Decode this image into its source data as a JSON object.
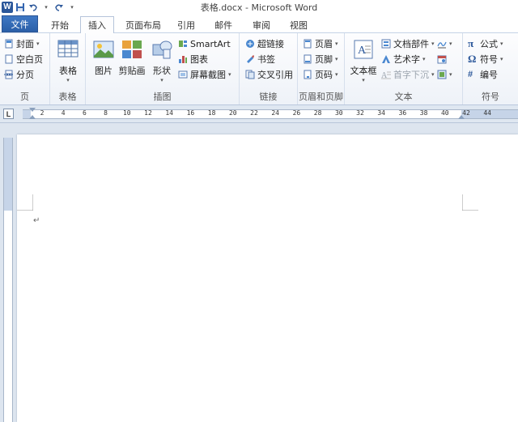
{
  "titlebar": {
    "title": "表格.docx - Microsoft Word",
    "logo": "W"
  },
  "tabs": [
    {
      "label": "文件"
    },
    {
      "label": "开始"
    },
    {
      "label": "插入"
    },
    {
      "label": "页面布局"
    },
    {
      "label": "引用"
    },
    {
      "label": "邮件"
    },
    {
      "label": "审阅"
    },
    {
      "label": "视图"
    }
  ],
  "ribbon": {
    "pages": {
      "label": "页",
      "cover": "封面",
      "blank": "空白页",
      "break": "分页"
    },
    "tables": {
      "label": "表格",
      "table": "表格"
    },
    "illustrations": {
      "label": "插图",
      "picture": "图片",
      "clipart": "剪贴画",
      "shapes": "形状",
      "smartart": "SmartArt",
      "chart": "图表",
      "screenshot": "屏幕截图"
    },
    "links": {
      "label": "链接",
      "hyperlink": "超链接",
      "bookmark": "书签",
      "crossref": "交叉引用"
    },
    "headerfooter": {
      "label": "页眉和页脚",
      "header": "页眉",
      "footer": "页脚",
      "pagenum": "页码"
    },
    "text": {
      "label": "文本",
      "textbox": "文本框",
      "quickparts": "文档部件",
      "wordart": "艺术字",
      "dropcap": "首字下沉"
    },
    "symbols": {
      "label": "符号",
      "equation": "公式",
      "symbol": "符号",
      "number": "编号"
    }
  },
  "ruler": {
    "labels": [
      "2",
      "4",
      "6",
      "8",
      "10",
      "12",
      "14",
      "16",
      "18",
      "20",
      "22",
      "24",
      "26",
      "28",
      "30",
      "32",
      "34",
      "36",
      "38",
      "40",
      "42",
      "44"
    ]
  },
  "colors": {
    "file_tab": "#2a5fa8",
    "ribbon_bg": "#eef2f8",
    "doc_bg": "#dde5ef",
    "accent": "#2b579a"
  }
}
